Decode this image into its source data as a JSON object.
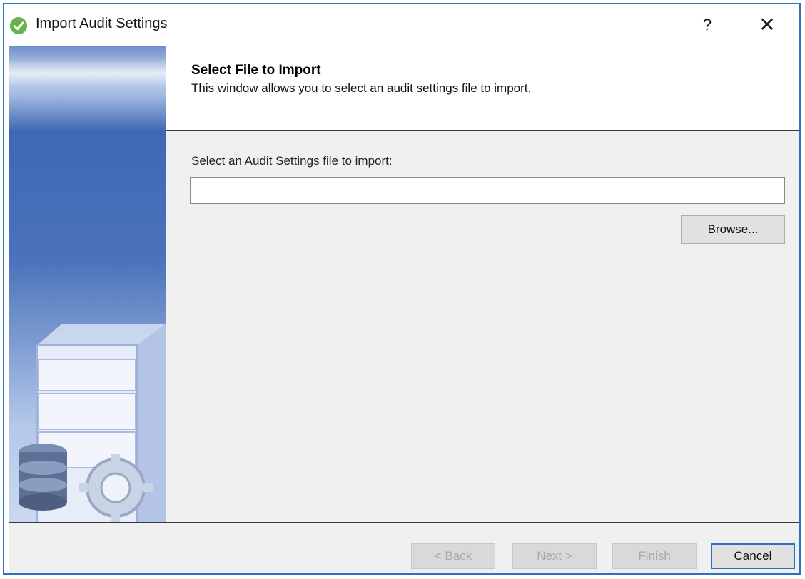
{
  "window": {
    "title": "Import Audit Settings",
    "help_label": "?",
    "close_label": "✕"
  },
  "header": {
    "title": "Select File to Import",
    "subtitle": "This window allows you to select an audit settings file to import."
  },
  "form": {
    "file_label": "Select an Audit Settings file to import:",
    "file_value": "",
    "browse_label": "Browse..."
  },
  "footer": {
    "back_label": "< Back",
    "next_label": "Next >",
    "finish_label": "Finish",
    "cancel_label": "Cancel"
  },
  "colors": {
    "accent": "#2f6fc4",
    "app_icon": "#6ab04c",
    "banner": "#4a73bb"
  }
}
